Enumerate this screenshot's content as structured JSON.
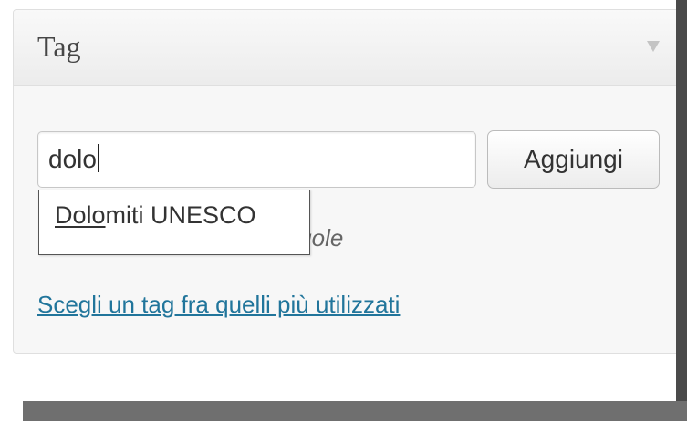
{
  "postbox": {
    "title": "Tag",
    "toggle_icon": "triangle-down-icon"
  },
  "tag_input": {
    "value": "dolo"
  },
  "add_button": {
    "label": "Aggiungi"
  },
  "hint": {
    "visible_text": "elle virgole"
  },
  "autocomplete": {
    "items": [
      {
        "match": "Dolo",
        "rest": "miti UNESCO"
      }
    ]
  },
  "tagcloud_link": {
    "label": "Scegli un tag fra quelli più utilizzati"
  },
  "colors": {
    "link": "#21759b",
    "text": "#333333",
    "panel_background": "#f7f7f7",
    "border": "#dfdfdf"
  }
}
